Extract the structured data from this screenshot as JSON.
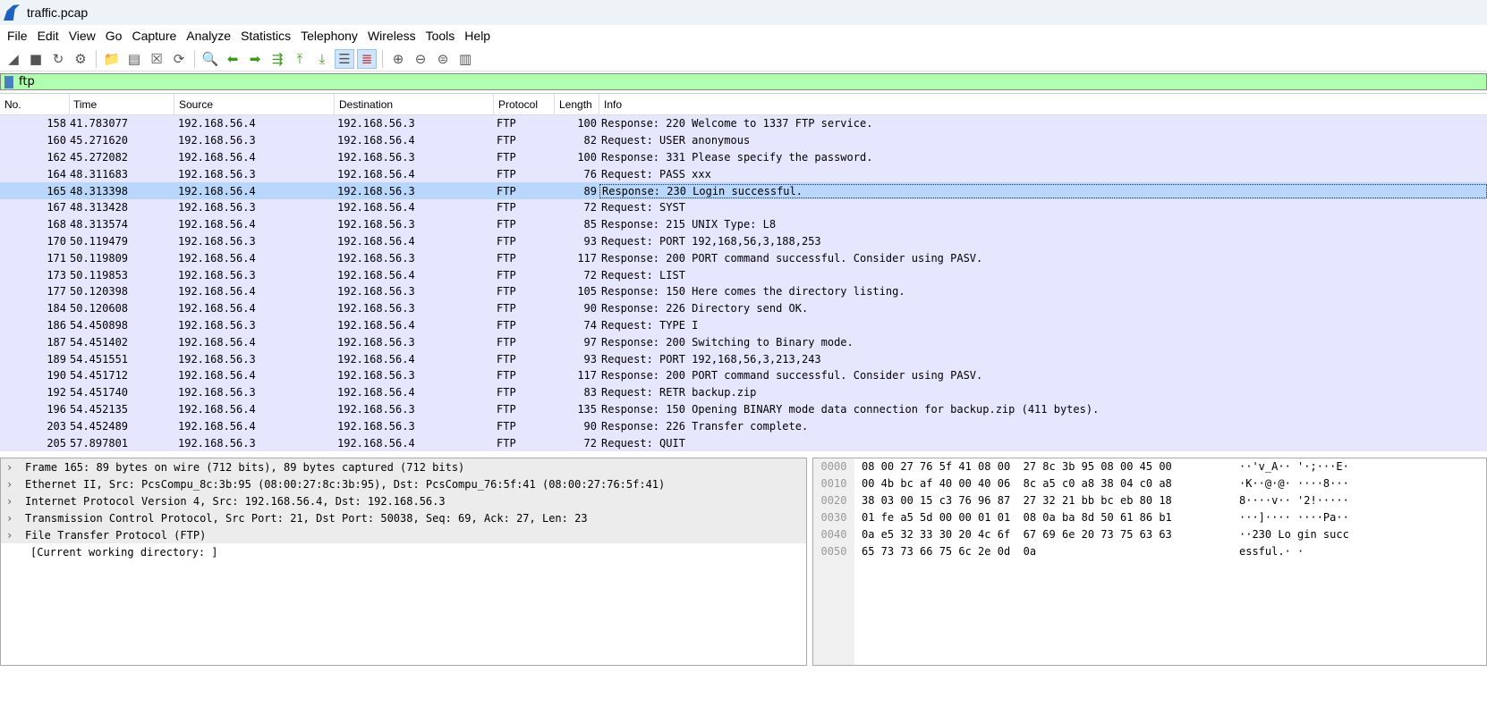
{
  "window": {
    "title": "traffic.pcap"
  },
  "menu": [
    "File",
    "Edit",
    "View",
    "Go",
    "Capture",
    "Analyze",
    "Statistics",
    "Telephony",
    "Wireless",
    "Tools",
    "Help"
  ],
  "toolbar": [
    "shark-fin-icon",
    "stop-icon",
    "restart-icon",
    "options-gear-icon",
    "open-folder-icon",
    "file-icon",
    "close-file-icon",
    "reload-icon",
    "find-icon",
    "back-arrow-icon",
    "forward-arrow-icon",
    "goto-packet-icon",
    "first-packet-icon",
    "last-packet-icon",
    "autoscroll-icon",
    "colorize-icon",
    "zoom-in-icon",
    "zoom-out-icon",
    "normal-size-icon",
    "resize-columns-icon"
  ],
  "filter": {
    "value": "ftp",
    "bg_color": "#afffaf"
  },
  "columns": [
    "No.",
    "Time",
    "Source",
    "Destination",
    "Protocol",
    "Length",
    "Info"
  ],
  "selected_no": "165",
  "packets": [
    [
      "158",
      "41.783077",
      "192.168.56.4",
      "192.168.56.3",
      "FTP",
      "100",
      "Response: 220 Welcome to 1337 FTP service."
    ],
    [
      "160",
      "45.271620",
      "192.168.56.3",
      "192.168.56.4",
      "FTP",
      "82",
      "Request: USER anonymous"
    ],
    [
      "162",
      "45.272082",
      "192.168.56.4",
      "192.168.56.3",
      "FTP",
      "100",
      "Response: 331 Please specify the password."
    ],
    [
      "164",
      "48.311683",
      "192.168.56.3",
      "192.168.56.4",
      "FTP",
      "76",
      "Request: PASS xxx"
    ],
    [
      "165",
      "48.313398",
      "192.168.56.4",
      "192.168.56.3",
      "FTP",
      "89",
      "Response: 230 Login successful."
    ],
    [
      "167",
      "48.313428",
      "192.168.56.3",
      "192.168.56.4",
      "FTP",
      "72",
      "Request: SYST"
    ],
    [
      "168",
      "48.313574",
      "192.168.56.4",
      "192.168.56.3",
      "FTP",
      "85",
      "Response: 215 UNIX Type: L8"
    ],
    [
      "170",
      "50.119479",
      "192.168.56.3",
      "192.168.56.4",
      "FTP",
      "93",
      "Request: PORT 192,168,56,3,188,253"
    ],
    [
      "171",
      "50.119809",
      "192.168.56.4",
      "192.168.56.3",
      "FTP",
      "117",
      "Response: 200 PORT command successful. Consider using PASV."
    ],
    [
      "173",
      "50.119853",
      "192.168.56.3",
      "192.168.56.4",
      "FTP",
      "72",
      "Request: LIST"
    ],
    [
      "177",
      "50.120398",
      "192.168.56.4",
      "192.168.56.3",
      "FTP",
      "105",
      "Response: 150 Here comes the directory listing."
    ],
    [
      "184",
      "50.120608",
      "192.168.56.4",
      "192.168.56.3",
      "FTP",
      "90",
      "Response: 226 Directory send OK."
    ],
    [
      "186",
      "54.450898",
      "192.168.56.3",
      "192.168.56.4",
      "FTP",
      "74",
      "Request: TYPE I"
    ],
    [
      "187",
      "54.451402",
      "192.168.56.4",
      "192.168.56.3",
      "FTP",
      "97",
      "Response: 200 Switching to Binary mode."
    ],
    [
      "189",
      "54.451551",
      "192.168.56.3",
      "192.168.56.4",
      "FTP",
      "93",
      "Request: PORT 192,168,56,3,213,243"
    ],
    [
      "190",
      "54.451712",
      "192.168.56.4",
      "192.168.56.3",
      "FTP",
      "117",
      "Response: 200 PORT command successful. Consider using PASV."
    ],
    [
      "192",
      "54.451740",
      "192.168.56.3",
      "192.168.56.4",
      "FTP",
      "83",
      "Request: RETR backup.zip"
    ],
    [
      "196",
      "54.452135",
      "192.168.56.4",
      "192.168.56.3",
      "FTP",
      "135",
      "Response: 150 Opening BINARY mode data connection for backup.zip (411 bytes)."
    ],
    [
      "203",
      "54.452489",
      "192.168.56.4",
      "192.168.56.3",
      "FTP",
      "90",
      "Response: 226 Transfer complete."
    ],
    [
      "205",
      "57.897801",
      "192.168.56.3",
      "192.168.56.4",
      "FTP",
      "72",
      "Request: QUIT"
    ]
  ],
  "details": [
    {
      "text": "Frame 165: 89 bytes on wire (712 bits), 89 bytes captured (712 bits)",
      "expandable": true
    },
    {
      "text": "Ethernet II, Src: PcsCompu_8c:3b:95 (08:00:27:8c:3b:95), Dst: PcsCompu_76:5f:41 (08:00:27:76:5f:41)",
      "expandable": true
    },
    {
      "text": "Internet Protocol Version 4, Src: 192.168.56.4, Dst: 192.168.56.3",
      "expandable": true
    },
    {
      "text": "Transmission Control Protocol, Src Port: 21, Dst Port: 50038, Seq: 69, Ack: 27, Len: 23",
      "expandable": true
    },
    {
      "text": "File Transfer Protocol (FTP)",
      "expandable": true
    },
    {
      "text": "[Current working directory: ]",
      "expandable": false
    }
  ],
  "bytes": [
    [
      "0000",
      "08 00 27 76 5f 41 08 00  27 8c 3b 95 08 00 45 00",
      "··'v_A·· '·;···E·"
    ],
    [
      "0010",
      "00 4b bc af 40 00 40 06  8c a5 c0 a8 38 04 c0 a8",
      "·K··@·@· ····8···"
    ],
    [
      "0020",
      "38 03 00 15 c3 76 96 87  27 32 21 bb bc eb 80 18",
      "8····v·· '2!·····"
    ],
    [
      "0030",
      "01 fe a5 5d 00 00 01 01  08 0a ba 8d 50 61 86 b1",
      "···]···· ····Pa··"
    ],
    [
      "0040",
      "0a e5 32 33 30 20 4c 6f  67 69 6e 20 73 75 63 63",
      "··230 Lo gin succ"
    ],
    [
      "0050",
      "65 73 73 66 75 6c 2e 0d  0a",
      "essful.· ·"
    ]
  ]
}
